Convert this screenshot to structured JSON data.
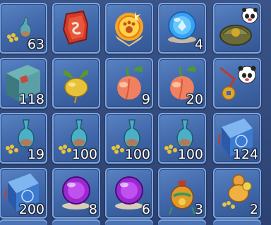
{
  "inventory": {
    "slots": [
      {
        "icon": "gourd-with-coins-icon",
        "count": "63"
      },
      {
        "icon": "red-seal-stone-icon",
        "count": ""
      },
      {
        "icon": "glowing-paw-medallion-icon",
        "count": ""
      },
      {
        "icon": "blue-crystal-orb-icon",
        "count": "4"
      },
      {
        "icon": "panda-treasure-turtle-icon",
        "count": ""
      },
      {
        "icon": "teal-book-icon",
        "count": "118"
      },
      {
        "icon": "golden-turnip-icon",
        "count": ""
      },
      {
        "icon": "peach-icon",
        "count": "9"
      },
      {
        "icon": "peach-icon",
        "count": "20"
      },
      {
        "icon": "panda-coin-charm-icon",
        "count": ""
      },
      {
        "icon": "blue-vase-with-coins-icon",
        "count": "19"
      },
      {
        "icon": "blue-vase-with-coins-icon",
        "count": "100"
      },
      {
        "icon": "blue-vase-with-coins-icon",
        "count": "100"
      },
      {
        "icon": "blue-vase-with-coins-icon",
        "count": "100"
      },
      {
        "icon": "blue-rune-tome-icon",
        "count": "124"
      },
      {
        "icon": "blue-rune-tome-icon",
        "count": "200"
      },
      {
        "icon": "purple-orb-icon",
        "count": "8"
      },
      {
        "icon": "purple-orb-icon",
        "count": "6"
      },
      {
        "icon": "coin-pouch-icon",
        "count": "3"
      },
      {
        "icon": "golden-gourd-coins-icon",
        "count": "2"
      }
    ]
  },
  "colors": {
    "slot": "#4a74b6",
    "border": "#7ea6e0",
    "background": "#2e4470"
  }
}
